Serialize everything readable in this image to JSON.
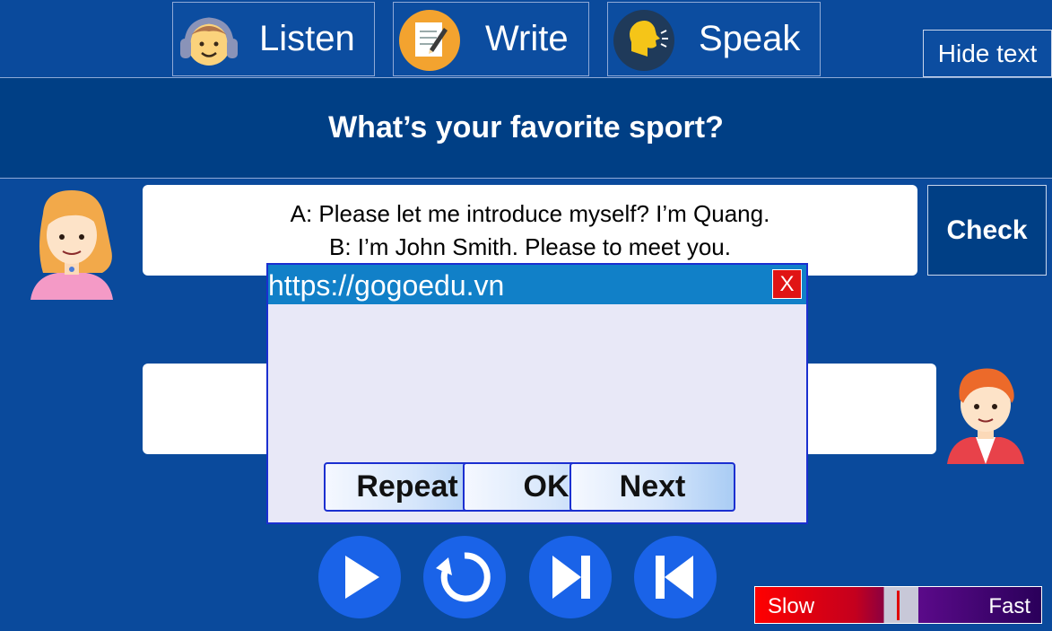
{
  "tabs": {
    "listen": "Listen",
    "write": "Write",
    "speak": "Speak"
  },
  "hide_text": "Hide text",
  "lesson_title": "What’s your favorite sport?",
  "dialogue": {
    "line_a": "A: Please let me introduce myself? I’m Quang.",
    "line_b": "B: I’m John Smith. Please to meet you."
  },
  "check_label": "Check",
  "modal": {
    "url": "https://gogoedu.vn",
    "close": "X",
    "repeat": "Repeat",
    "ok": "OK",
    "next": "Next"
  },
  "speed": {
    "slow": "Slow",
    "fast": "Fast"
  },
  "icons": {
    "play": "play-icon",
    "replay": "replay-icon",
    "next": "skip-next-icon",
    "prev": "skip-previous-icon"
  },
  "colors": {
    "background": "#0a4a9c",
    "title_bar": "#003f85",
    "control_button": "#1a63e8",
    "modal_header": "#1180c8",
    "close_button": "#e01414"
  }
}
